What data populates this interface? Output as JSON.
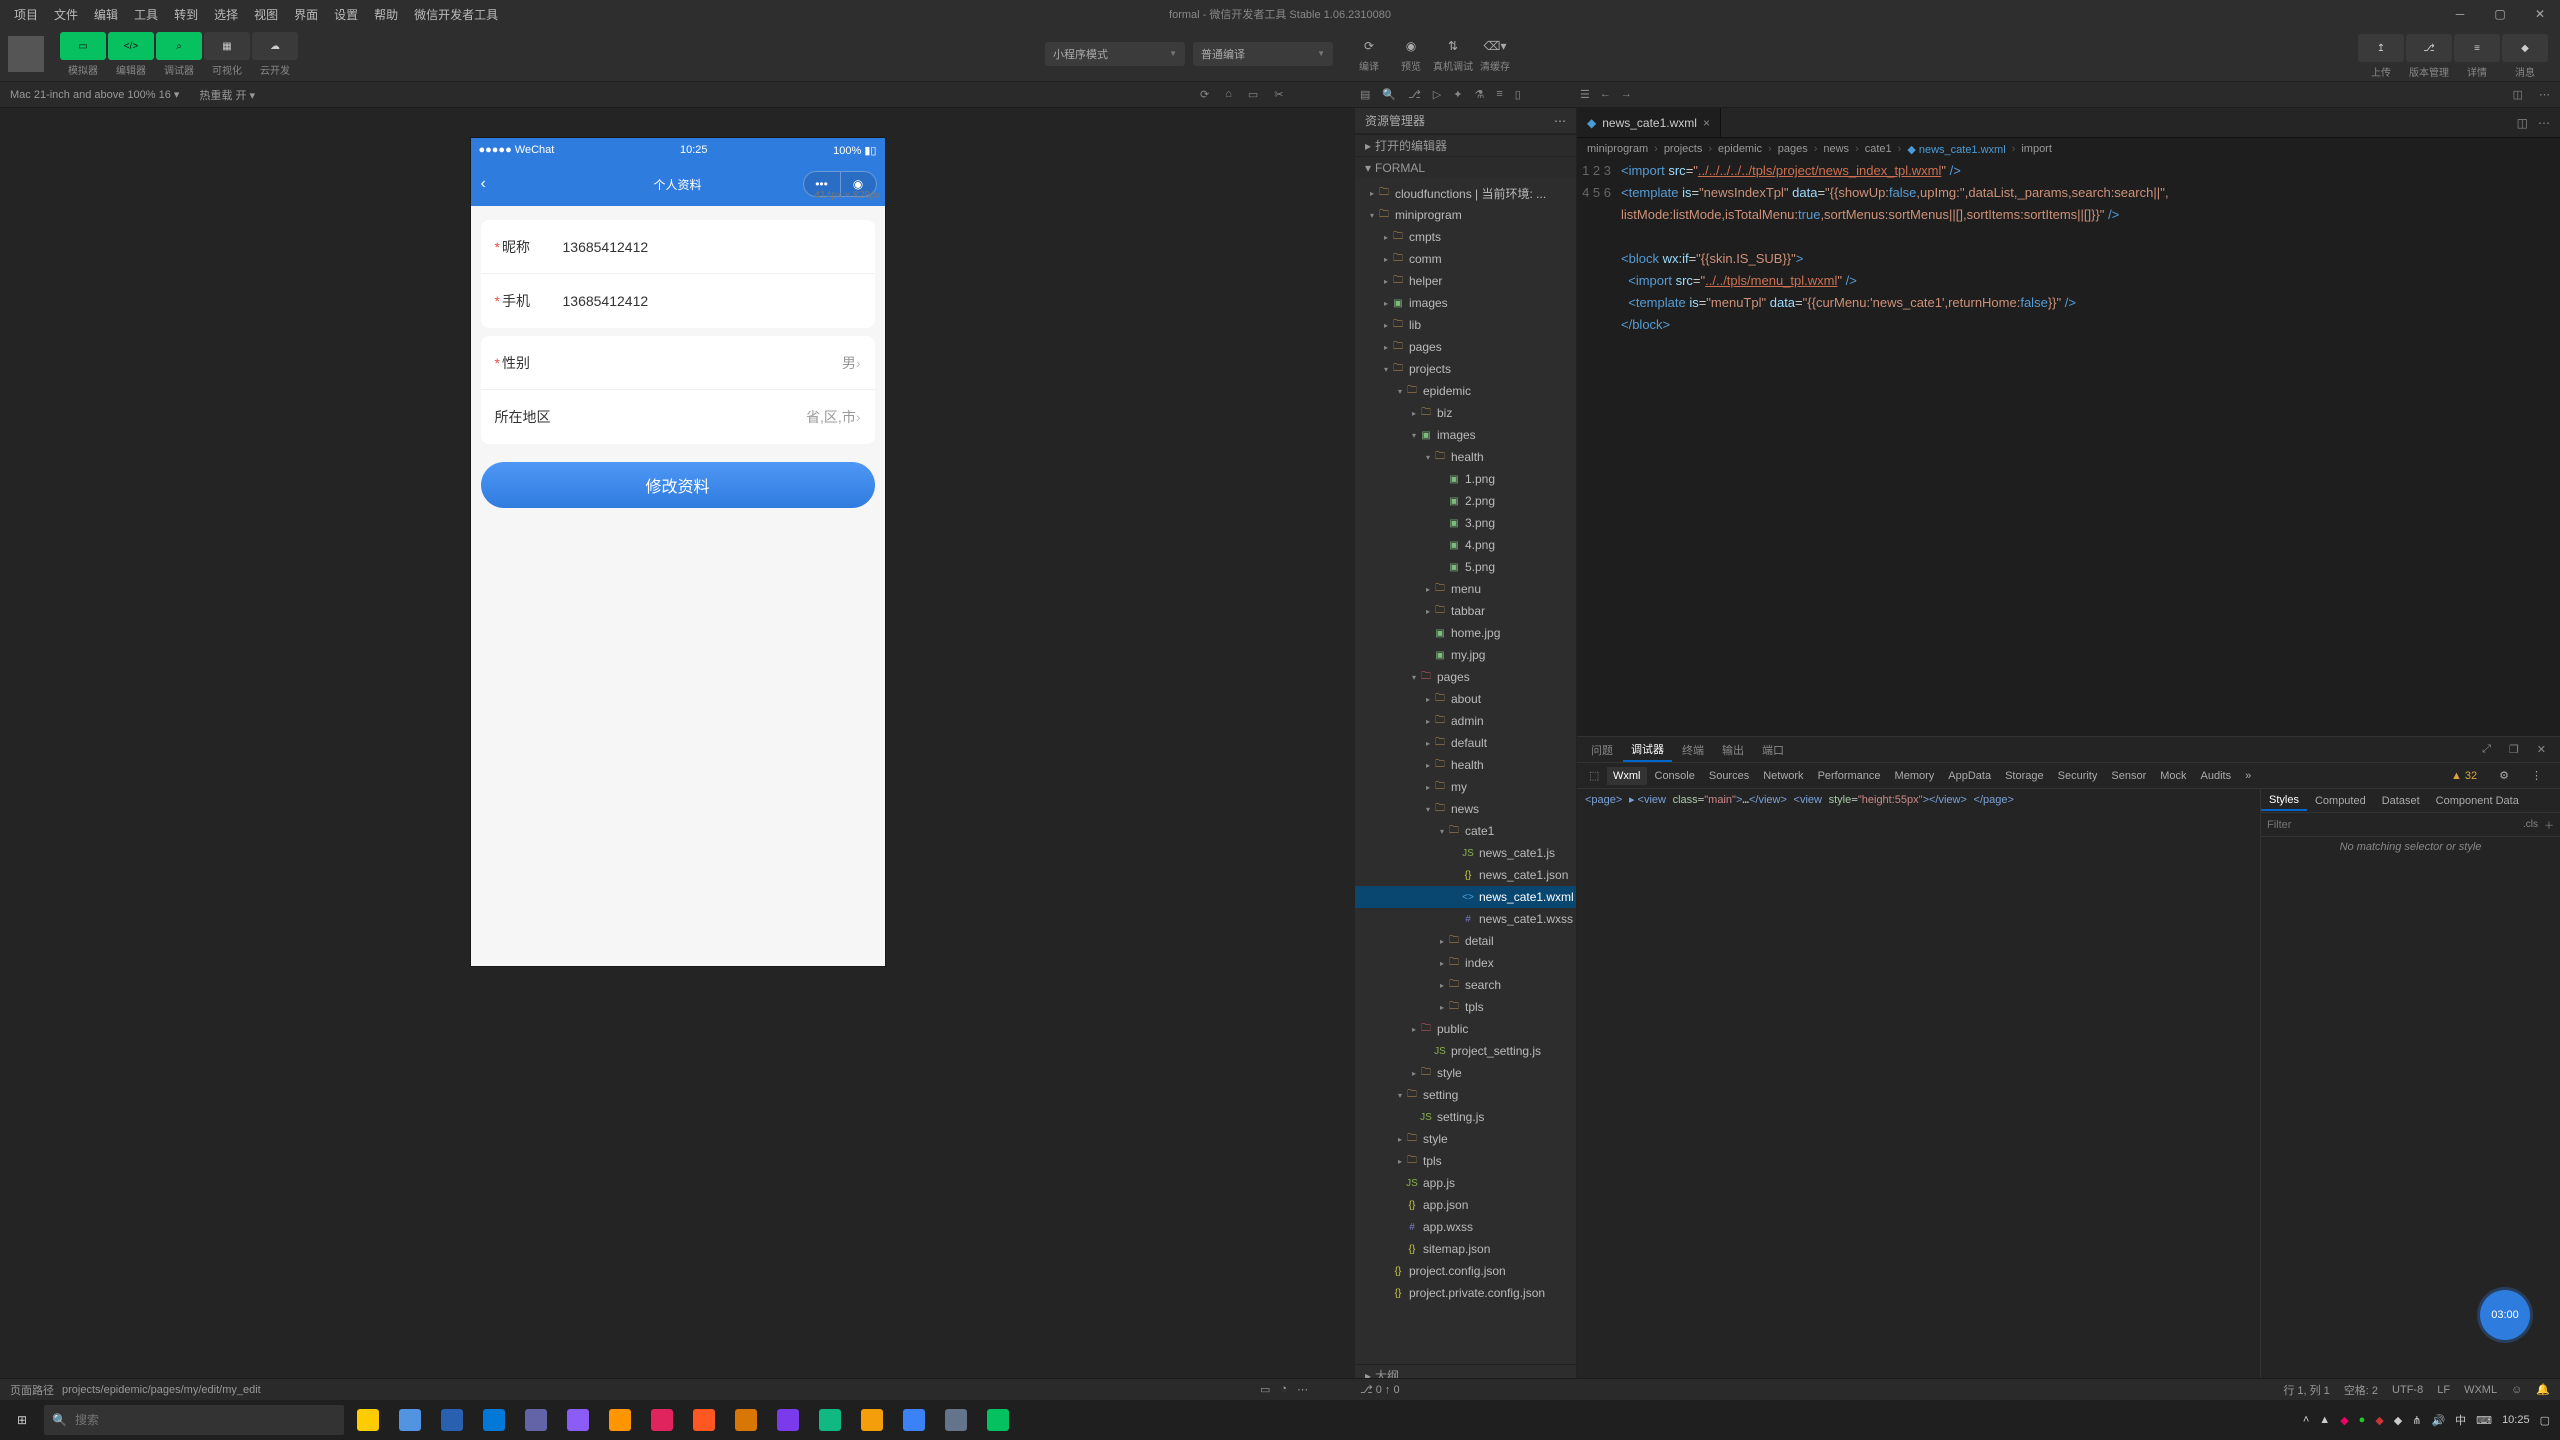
{
  "menubar": {
    "items": [
      "项目",
      "文件",
      "编辑",
      "工具",
      "转到",
      "选择",
      "视图",
      "界面",
      "设置",
      "帮助",
      "微信开发者工具"
    ],
    "title": "formal - 微信开发者工具 Stable 1.06.2310080"
  },
  "toolbar": {
    "left_group": {
      "labels": [
        "模拟器",
        "编辑器",
        "调试器",
        "可视化",
        "云开发"
      ]
    },
    "mode_select": "小程序模式",
    "compile_select": "普通编译",
    "center_icons": [
      {
        "label": "编译"
      },
      {
        "label": "预览"
      },
      {
        "label": "真机调试"
      },
      {
        "label": "清缓存"
      }
    ],
    "right_group": {
      "labels": [
        "上传",
        "版本管理",
        "详情",
        "消息"
      ]
    }
  },
  "strip2": {
    "device": "Mac 21-inch and above 100% 16 ▾",
    "hot": "热重载 开 ▾"
  },
  "simulator": {
    "status_left": "●●●●● WeChat",
    "status_time": "10:25",
    "status_right": "100%",
    "nav_title": "个人资料",
    "dim_label": "414px × 828px",
    "fields": [
      {
        "label": "昵称",
        "required": true,
        "value": "13685412412",
        "type": "input"
      },
      {
        "label": "手机",
        "required": true,
        "value": "13685412412",
        "type": "input"
      }
    ],
    "pickers": [
      {
        "label": "性别",
        "required": true,
        "value": "男"
      },
      {
        "label": "所在地区",
        "required": false,
        "value": "省,区,市"
      }
    ],
    "submit_btn": "修改资料"
  },
  "explorer": {
    "header": "资源管理器",
    "open_editors": "打开的编辑器",
    "root": "FORMAL",
    "tree": [
      {
        "depth": 0,
        "twisty": "▸",
        "ico": "folder",
        "label": "cloudfunctions | 当前环境: ..."
      },
      {
        "depth": 0,
        "twisty": "▾",
        "ico": "folder",
        "label": "miniprogram"
      },
      {
        "depth": 1,
        "twisty": "▸",
        "ico": "folder",
        "label": "cmpts"
      },
      {
        "depth": 1,
        "twisty": "▸",
        "ico": "folder",
        "label": "comm"
      },
      {
        "depth": 1,
        "twisty": "▸",
        "ico": "folder",
        "label": "helper"
      },
      {
        "depth": 1,
        "twisty": "▸",
        "ico": "img",
        "label": "images"
      },
      {
        "depth": 1,
        "twisty": "▸",
        "ico": "folder",
        "label": "lib"
      },
      {
        "depth": 1,
        "twisty": "▸",
        "ico": "folder",
        "label": "pages"
      },
      {
        "depth": 1,
        "twisty": "▾",
        "ico": "folder",
        "label": "projects"
      },
      {
        "depth": 2,
        "twisty": "▾",
        "ico": "folder",
        "label": "epidemic"
      },
      {
        "depth": 3,
        "twisty": "▸",
        "ico": "folder",
        "label": "biz"
      },
      {
        "depth": 3,
        "twisty": "▾",
        "ico": "img",
        "label": "images"
      },
      {
        "depth": 4,
        "twisty": "▾",
        "ico": "folder",
        "label": "health"
      },
      {
        "depth": 5,
        "twisty": "",
        "ico": "img",
        "label": "1.png"
      },
      {
        "depth": 5,
        "twisty": "",
        "ico": "img",
        "label": "2.png"
      },
      {
        "depth": 5,
        "twisty": "",
        "ico": "img",
        "label": "3.png"
      },
      {
        "depth": 5,
        "twisty": "",
        "ico": "img",
        "label": "4.png"
      },
      {
        "depth": 5,
        "twisty": "",
        "ico": "img",
        "label": "5.png"
      },
      {
        "depth": 4,
        "twisty": "▸",
        "ico": "folder",
        "label": "menu"
      },
      {
        "depth": 4,
        "twisty": "▸",
        "ico": "folder",
        "label": "tabbar"
      },
      {
        "depth": 4,
        "twisty": "",
        "ico": "img",
        "label": "home.jpg"
      },
      {
        "depth": 4,
        "twisty": "",
        "ico": "img",
        "label": "my.jpg"
      },
      {
        "depth": 3,
        "twisty": "▾",
        "ico": "red",
        "label": "pages"
      },
      {
        "depth": 4,
        "twisty": "▸",
        "ico": "folder",
        "label": "about"
      },
      {
        "depth": 4,
        "twisty": "▸",
        "ico": "folder",
        "label": "admin"
      },
      {
        "depth": 4,
        "twisty": "▸",
        "ico": "folder",
        "label": "default"
      },
      {
        "depth": 4,
        "twisty": "▸",
        "ico": "folder",
        "label": "health"
      },
      {
        "depth": 4,
        "twisty": "▸",
        "ico": "folder",
        "label": "my"
      },
      {
        "depth": 4,
        "twisty": "▾",
        "ico": "folder",
        "label": "news"
      },
      {
        "depth": 5,
        "twisty": "▾",
        "ico": "folder",
        "label": "cate1"
      },
      {
        "depth": 6,
        "twisty": "",
        "ico": "js",
        "label": "news_cate1.js"
      },
      {
        "depth": 6,
        "twisty": "",
        "ico": "json",
        "label": "news_cate1.json"
      },
      {
        "depth": 6,
        "twisty": "",
        "ico": "wxml",
        "label": "news_cate1.wxml",
        "selected": true
      },
      {
        "depth": 6,
        "twisty": "",
        "ico": "wxss",
        "label": "news_cate1.wxss"
      },
      {
        "depth": 5,
        "twisty": "▸",
        "ico": "folder",
        "label": "detail"
      },
      {
        "depth": 5,
        "twisty": "▸",
        "ico": "folder",
        "label": "index"
      },
      {
        "depth": 5,
        "twisty": "▸",
        "ico": "folder",
        "label": "search"
      },
      {
        "depth": 5,
        "twisty": "▸",
        "ico": "folder",
        "label": "tpls"
      },
      {
        "depth": 3,
        "twisty": "▸",
        "ico": "red",
        "label": "public"
      },
      {
        "depth": 4,
        "twisty": "",
        "ico": "js",
        "label": "project_setting.js"
      },
      {
        "depth": 3,
        "twisty": "▸",
        "ico": "folder",
        "label": "style"
      },
      {
        "depth": 2,
        "twisty": "▾",
        "ico": "folder",
        "label": "setting"
      },
      {
        "depth": 3,
        "twisty": "",
        "ico": "js",
        "label": "setting.js"
      },
      {
        "depth": 2,
        "twisty": "▸",
        "ico": "folder",
        "label": "style"
      },
      {
        "depth": 2,
        "twisty": "▸",
        "ico": "folder",
        "label": "tpls"
      },
      {
        "depth": 2,
        "twisty": "",
        "ico": "js",
        "label": "app.js"
      },
      {
        "depth": 2,
        "twisty": "",
        "ico": "json",
        "label": "app.json"
      },
      {
        "depth": 2,
        "twisty": "",
        "ico": "wxss",
        "label": "app.wxss"
      },
      {
        "depth": 2,
        "twisty": "",
        "ico": "json",
        "label": "sitemap.json"
      },
      {
        "depth": 1,
        "twisty": "",
        "ico": "json",
        "label": "project.config.json"
      },
      {
        "depth": 1,
        "twisty": "",
        "ico": "json",
        "label": "project.private.config.json"
      }
    ],
    "outline_label": "大纲"
  },
  "editor": {
    "tab_name": "news_cate1.wxml",
    "breadcrumb": [
      "miniprogram",
      "projects",
      "epidemic",
      "pages",
      "news",
      "cate1",
      "news_cate1.wxml",
      "import"
    ]
  },
  "devtools": {
    "top_tabs": [
      "问题",
      "调试器",
      "终端",
      "输出",
      "端口"
    ],
    "active_top": 1,
    "sub_tabs": [
      "Wxml",
      "Console",
      "Sources",
      "Network",
      "Performance",
      "Memory",
      "AppData",
      "Storage",
      "Security",
      "Sensor",
      "Mock",
      "Audits"
    ],
    "active_sub": 0,
    "warn_count": "▲ 32",
    "style_tabs": [
      "Styles",
      "Computed",
      "Dataset",
      "Component Data"
    ],
    "filter_placeholder": "Filter",
    "cls_label": ".cls",
    "no_match": "No matching selector or style"
  },
  "ide_status": {
    "left_label": "页面路径",
    "path": "projects/epidemic/pages/my/edit/my_edit",
    "git": "⎇ 0 ↑ 0",
    "pos": "行 1, 列 1",
    "spaces": "空格: 2",
    "enc": "UTF-8",
    "eol": "LF",
    "lang": "WXML"
  },
  "taskbar": {
    "search_placeholder": "搜索",
    "time": "10:25",
    "apps_count": 16
  },
  "float_btn": "03:00"
}
